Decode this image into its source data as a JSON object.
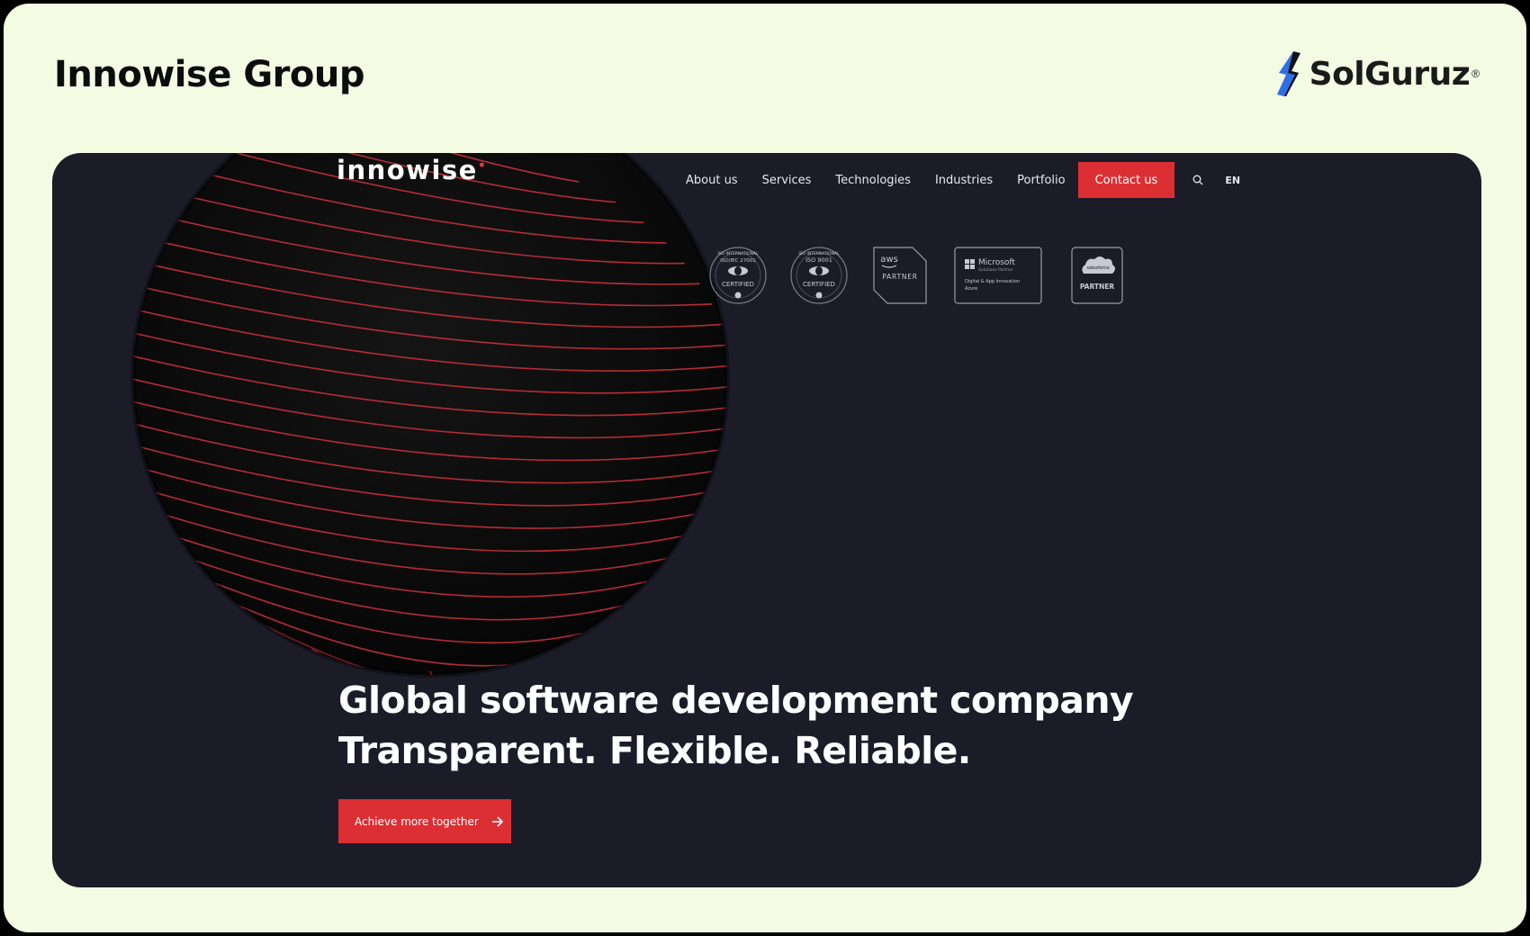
{
  "header": {
    "title": "Innowise Group",
    "brand": {
      "name": "SolGuruz",
      "mark": "®"
    }
  },
  "site": {
    "logo": {
      "text": "innowise",
      "dot": "•"
    },
    "nav": {
      "items": [
        "About us",
        "Services",
        "Technologies",
        "Industries",
        "Portfolio"
      ],
      "contact_label": "Contact us",
      "lang": "EN"
    },
    "badges": [
      {
        "name": "iso-27001",
        "top": "ISO INTERNATIONAL",
        "line1": "ISO/IEC 27001",
        "line2": "CERTIFIED"
      },
      {
        "name": "iso-9001",
        "top": "ISO INTERNATIONAL",
        "line1": "ISO 9001",
        "line2": "CERTIFIED"
      },
      {
        "name": "aws",
        "line1": "aws",
        "line2": "PARTNER"
      },
      {
        "name": "microsoft",
        "line1": "Microsoft",
        "line2": "Solutions Partner",
        "line3": "Digital & App Innovation",
        "line4": "Azure"
      },
      {
        "name": "salesforce",
        "line1": "salesforce",
        "line2": "PARTNER"
      }
    ],
    "hero": {
      "line1": "Global software development company",
      "line2": "Transparent. Flexible. Reliable.",
      "cta_label": "Achieve more together"
    }
  },
  "colors": {
    "page_bg": "#f3fbe3",
    "site_bg": "#1b1c28",
    "accent": "#dc2f33",
    "brand_blue": "#2f6fe6"
  },
  "icons": {
    "search": "search-icon",
    "cta": "arrow-right-icon"
  }
}
